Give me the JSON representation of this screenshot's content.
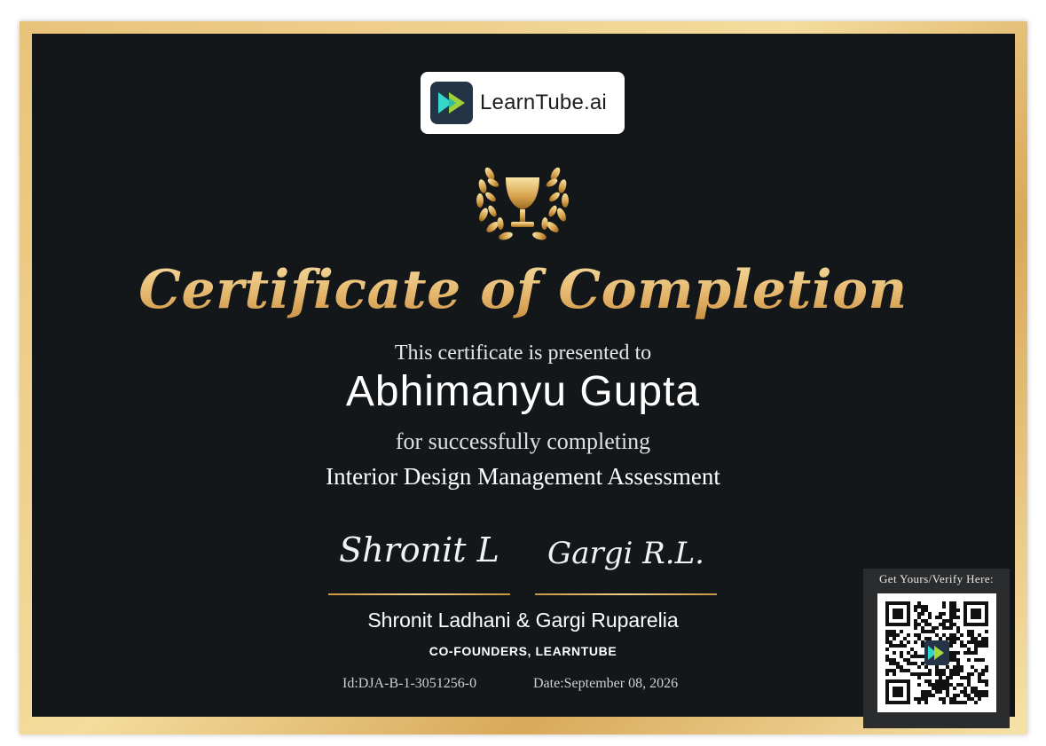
{
  "logo": {
    "text": "LearnTube.ai",
    "mark_color": "#243447",
    "icon_colors": [
      "#35d6c9",
      "#a6d93a"
    ]
  },
  "certificate": {
    "title": "Certificate of Completion",
    "presented_text": "This certificate is presented to",
    "recipient_name": "Abhimanyu Gupta",
    "completing_text": "for successfully completing",
    "course_name": "Interior Design Management Assessment"
  },
  "signatures": {
    "signature_1": "Shronit L",
    "signature_2": "Gargi R.L.",
    "founders_names": "Shronit Ladhani & Gargi Ruparelia",
    "founders_title": "CO-FOUNDERS, LEARNTUBE"
  },
  "meta": {
    "id": "Id:DJA-B-1-3051256-0",
    "date": "Date:September 08, 2026"
  },
  "verify": {
    "label": "Get Yours/Verify Here:"
  },
  "colors": {
    "background": "#141719",
    "gold": "#e3b46a",
    "text": "#ffffff"
  }
}
